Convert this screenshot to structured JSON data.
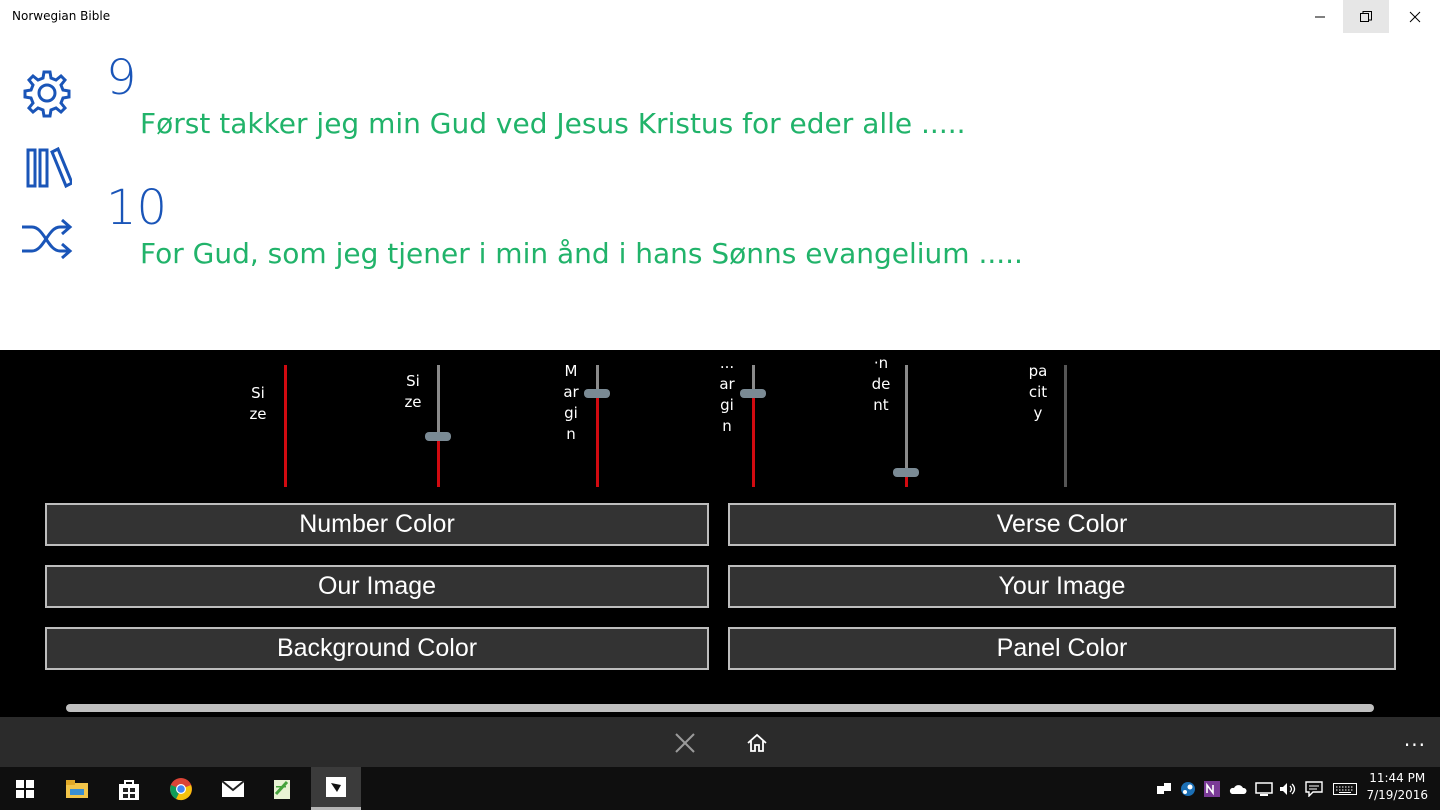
{
  "window": {
    "title": "Norwegian Bible"
  },
  "verses": [
    {
      "number": "9",
      "text": "Først takker jeg min Gud ved Jesus Kristus for eder alle ....."
    },
    {
      "number": "10",
      "text": "For Gud, som jeg tjener i min ånd i hans Sønns evangelium ....."
    }
  ],
  "sliders": [
    {
      "label": "Size",
      "value": 0.0
    },
    {
      "label": "Size",
      "value": 0.42
    },
    {
      "label": "Margin",
      "value": 0.77
    },
    {
      "label": "...argin",
      "value": 0.77
    },
    {
      "label": "·ndent",
      "value": 0.12
    },
    {
      "label": "pacity",
      "value": null
    }
  ],
  "buttons": {
    "number_color": "Number Color",
    "verse_color": "Verse Color",
    "our_image": "Our Image",
    "your_image": "Your Image",
    "background_color": "Background Color",
    "panel_color": "Panel Color"
  },
  "appbar": {
    "more": "..."
  },
  "taskbar": {
    "time": "11:44 PM",
    "date": "7/19/2016"
  },
  "colors": {
    "verse_number": "#1a55b8",
    "verse_text": "#21b36a",
    "slider_fill": "#d10a10",
    "panel": "#000000"
  }
}
